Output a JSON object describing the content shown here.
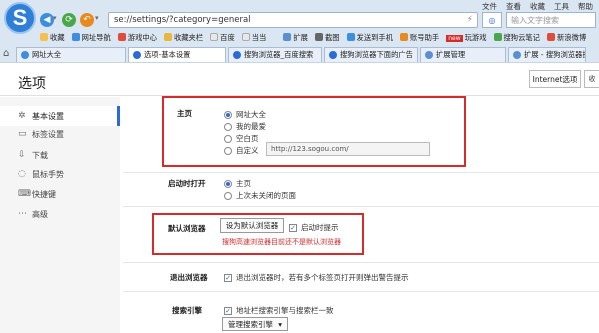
{
  "browser": {
    "address": "se://settings/?category=general",
    "search_placeholder": "输入文字搜索",
    "top_menu": [
      "文件",
      "查看",
      "收藏",
      "工具",
      "帮助"
    ],
    "bookmarks": [
      "收藏",
      "网址导航",
      "游戏中心",
      "收藏夹栏",
      "百度",
      "当当",
      "扩展",
      "截图",
      "发送到手机",
      "账号助手",
      "玩游戏",
      "搜狗云笔记",
      "新浪微博"
    ],
    "bookmark_badge": "new",
    "tabs": [
      "网址大全",
      "选项-基本设置",
      "搜狗浏览器_百度搜索",
      "搜狗浏览器下面的广告",
      "扩展管理",
      "扩展 - 搜狗浏览器扩展中心"
    ]
  },
  "page": {
    "title": "选项",
    "ie_button": "Internet选项",
    "more_button": "收"
  },
  "sidebar": {
    "items": [
      {
        "label": "基本设置",
        "icon": "gear-icon"
      },
      {
        "label": "标签设置",
        "icon": "tab-icon"
      },
      {
        "label": "下载",
        "icon": "download-icon"
      },
      {
        "label": "鼠标手势",
        "icon": "mouse-icon"
      },
      {
        "label": "快捷键",
        "icon": "keyboard-icon"
      },
      {
        "label": "高级",
        "icon": "ellipsis-icon"
      }
    ]
  },
  "homepage": {
    "label": "主页",
    "options": [
      "网址大全",
      "我的最爱",
      "空白页",
      "自定义"
    ],
    "selected": "网址大全",
    "custom_value": "http://123.sogou.com/"
  },
  "startup": {
    "label": "启动时打开",
    "options": [
      "主页",
      "上次未关闭的页面"
    ],
    "selected": "主页"
  },
  "default_browser": {
    "label": "默认浏览器",
    "button": "设为默认浏览器",
    "checkbox": "启动时提示",
    "checked": true,
    "warning": "搜狗高速浏览器目前还不是默认浏览器"
  },
  "exit": {
    "label": "退出浏览器",
    "checkbox": "退出浏览器时，若有多个标签页打开则弹出警告提示",
    "checked": true
  },
  "search_engine": {
    "label": "搜索引擎",
    "checkbox": "地址栏搜索引擎与搜索栏一致",
    "checked": true,
    "manage_button": "管理搜索引擎"
  },
  "colors": {
    "accent": "#2a6bd6",
    "highlight_box": "#d42b2b",
    "warning_text": "#d42b2b"
  }
}
